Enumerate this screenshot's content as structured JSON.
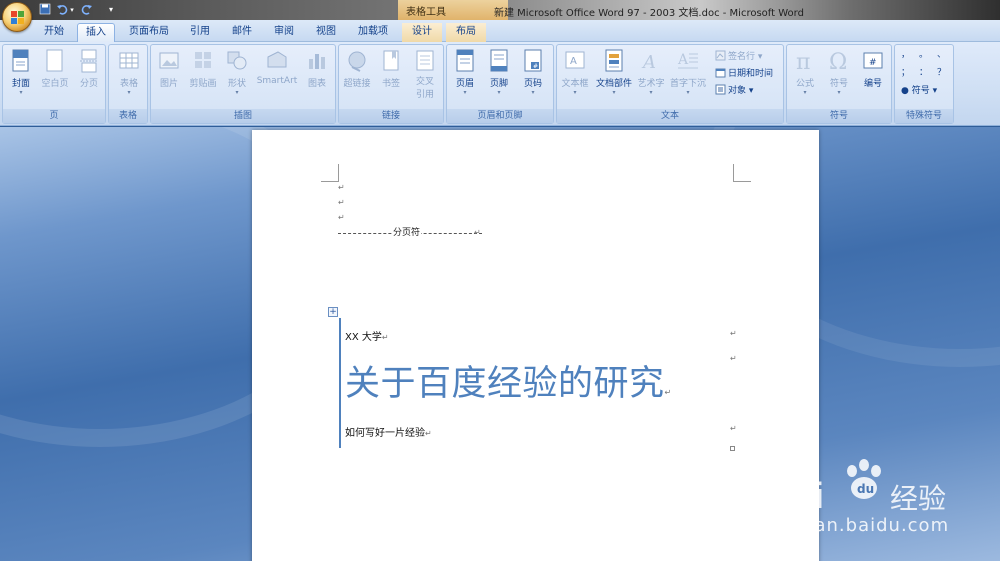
{
  "window": {
    "title": "新建 Microsoft Office Word 97 - 2003 文档.doc - Microsoft Word",
    "context_tools_label": "表格工具"
  },
  "quick_access": {
    "save": "save-icon",
    "undo": "undo-icon",
    "redo": "redo-icon",
    "customize": "▾"
  },
  "tabs": [
    {
      "label": "开始"
    },
    {
      "label": "插入"
    },
    {
      "label": "页面布局"
    },
    {
      "label": "引用"
    },
    {
      "label": "邮件"
    },
    {
      "label": "审阅"
    },
    {
      "label": "视图"
    },
    {
      "label": "加载项"
    },
    {
      "label": "设计"
    },
    {
      "label": "布局"
    }
  ],
  "active_tab": "插入",
  "ribbon": {
    "groups": {
      "pages": {
        "label": "页",
        "cover": "封面",
        "blank": "空白页",
        "break": "分页"
      },
      "tables": {
        "label": "表格",
        "table": "表格"
      },
      "illustrations": {
        "label": "插图",
        "picture": "图片",
        "clipart": "剪贴画",
        "shapes": "形状",
        "smartart": "SmartArt",
        "chart": "图表"
      },
      "links": {
        "label": "链接",
        "hyperlink": "超链接",
        "bookmark": "书签",
        "crossref_1": "交叉",
        "crossref_2": "引用"
      },
      "header_footer": {
        "label": "页眉和页脚",
        "header": "页眉",
        "footer": "页脚",
        "page_number": "页码"
      },
      "text": {
        "label": "文本",
        "textbox": "文本框",
        "quickparts": "文档部件",
        "wordart": "艺术字",
        "dropcap": "首字下沉",
        "signature": "签名行",
        "datetime": "日期和时间",
        "object": "对象"
      },
      "symbols": {
        "label": "符号",
        "equation": "公式",
        "symbol": "符号",
        "numbering": "编号"
      },
      "special": {
        "label": "特殊符号",
        "marks": [
          "，",
          "。",
          "、",
          "；",
          "：",
          "？"
        ],
        "symbol": "符号"
      }
    }
  },
  "document": {
    "page_break_text": "分页符",
    "university": "XX 大学",
    "title": "关于百度经验的研究",
    "subtitle": "如何写好一片经验"
  },
  "watermark": {
    "brand": "Bai",
    "brand_cn": "经验",
    "url": "jingyan.baidu.com"
  },
  "colors": {
    "accent": "#4f81bd",
    "ribbon_bg": "#dfeafa",
    "workspace": "#3f6eac"
  }
}
